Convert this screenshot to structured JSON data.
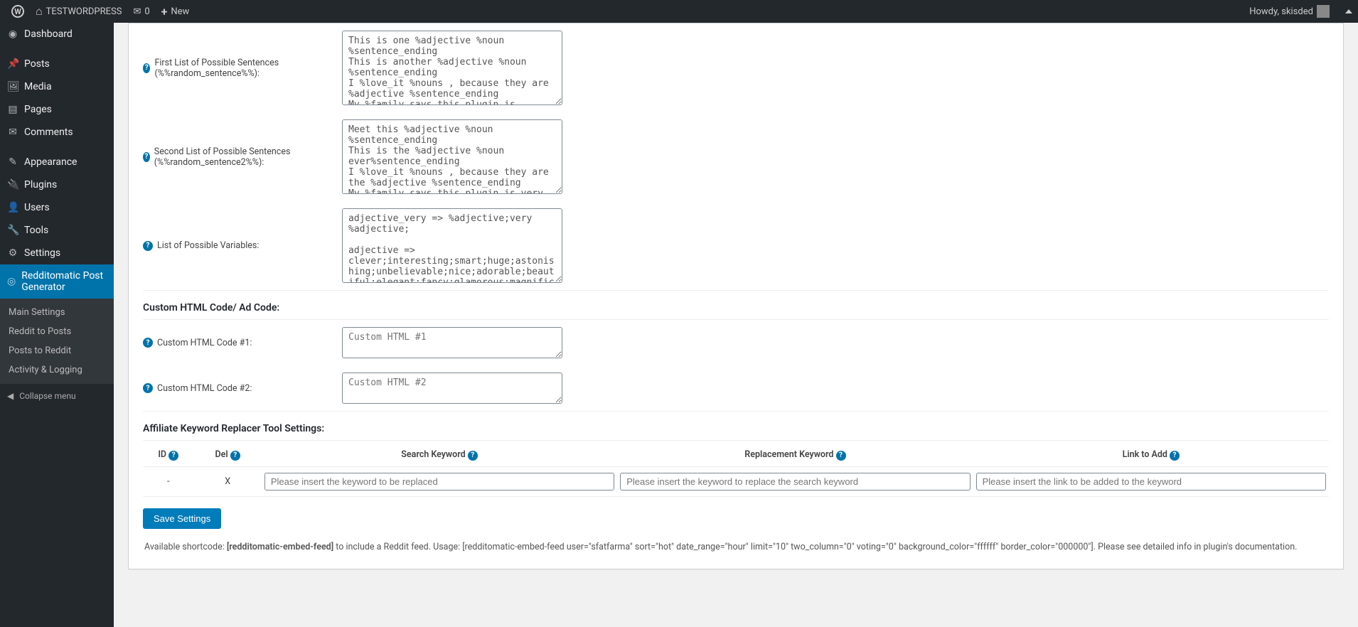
{
  "topbar": {
    "site_name": "TESTWORDPRESS",
    "comment_count": "0",
    "new_label": "New",
    "howdy": "Howdy, skisded"
  },
  "sidebar": {
    "dashboard": "Dashboard",
    "posts": "Posts",
    "media": "Media",
    "pages": "Pages",
    "comments": "Comments",
    "appearance": "Appearance",
    "plugins": "Plugins",
    "users": "Users",
    "tools": "Tools",
    "settings": "Settings",
    "active": "Redditomatic Post Generator",
    "sub_main": "Main Settings",
    "sub_r2p": "Reddit to Posts",
    "sub_p2r": "Posts to Reddit",
    "sub_log": "Activity & Logging",
    "collapse": "Collapse menu"
  },
  "form": {
    "first_label": "First List of Possible Sentences (%%random_sentence%%):",
    "first_value": "This is one %adjective %noun %sentence_ending\nThis is another %adjective %noun %sentence_ending\nI %love_it %nouns , because they are %adjective %sentence_ending\nMy %family says this plugin is %adjective %sentence_ending\nThese %nouns are %adjective %sentence_ending",
    "second_label": "Second List of Possible Sentences (%%random_sentence2%%):",
    "second_value": "Meet this %adjective %noun %sentence_ending\nThis is the %adjective %noun ever%sentence_ending\nI %love_it %nouns , because they are the %adjective %sentence_ending\nMy %family says this plugin is very %adjective %sentence_ending\nThese %nouns are quite %adjective %sentence_ending",
    "vars_label": "List of Possible Variables:",
    "vars_value": "adjective_very => %adjective;very %adjective;\n\nadjective => clever;interesting;smart;huge;astonishing;unbelievable;nice;adorable;beautiful;elegant;fancy;glamorous;magnificent;helpful;awesome\n\nnoun_with_adjective => %noun;%adjective %noun",
    "html_section": "Custom HTML Code/ Ad Code:",
    "html1_label": "Custom HTML Code #1:",
    "html1_placeholder": "Custom HTML #1",
    "html2_label": "Custom HTML Code #2:",
    "html2_placeholder": "Custom HTML #2",
    "affiliate_section": "Affiliate Keyword Replacer Tool Settings:",
    "th_id": "ID",
    "th_del": "Del",
    "th_search": "Search Keyword",
    "th_replace": "Replacement Keyword",
    "th_link": "Link to Add",
    "row_id": "-",
    "row_del": "X",
    "ph_search": "Please insert the keyword to be replaced",
    "ph_replace": "Please insert the keyword to replace the search keyword",
    "ph_link": "Please insert the link to be added to the keyword",
    "save": "Save Settings",
    "shortcode_prefix": "Available shortcode: ",
    "shortcode_name": "[redditomatic-embed-feed]",
    "shortcode_mid": " to include a Reddit feed. Usage: [redditomatic-embed-feed user=\"sfatfarma\" sort=\"hot\" date_range=\"hour\" limit=\"10\" two_column=\"0\" voting=\"0\" background_color=\"ffffff\" border_color=\"000000\"]. Please see detailed info in plugin's documentation."
  }
}
